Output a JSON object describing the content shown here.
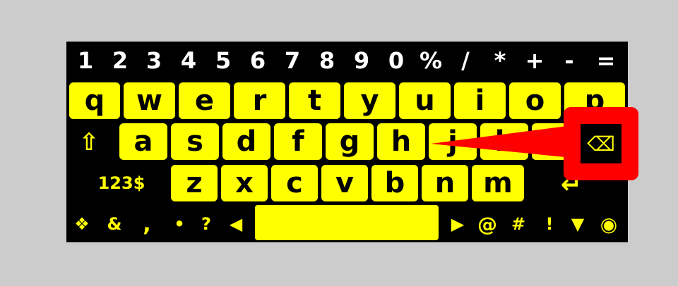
{
  "keyboard": {
    "number_row": [
      "1",
      "2",
      "3",
      "4",
      "5",
      "6",
      "7",
      "8",
      "9",
      "0",
      "%",
      "/",
      "*",
      "+",
      "-",
      "="
    ],
    "row1": [
      "q",
      "w",
      "e",
      "r",
      "t",
      "y",
      "u",
      "i",
      "o",
      "p"
    ],
    "row2": [
      "a",
      "s",
      "d",
      "f",
      "g",
      "h",
      "j",
      "k"
    ],
    "row3": [
      "z",
      "x",
      "c",
      "v",
      "b",
      "n",
      "m"
    ],
    "shift_label": "⇧",
    "mode_label": "123$",
    "enter_label": "↵",
    "space_label": "",
    "bottom_left": [
      "❖",
      "&",
      ",",
      "•",
      "?",
      "◀"
    ],
    "bottom_right": [
      "▶",
      "@",
      "#",
      "!",
      "▼",
      "◉"
    ],
    "backspace_label": "⌫"
  },
  "colors": {
    "key_fill": "#ffff00",
    "keyboard_bg": "#000000",
    "callout": "#ff0000",
    "page_bg": "#cccccc"
  },
  "icons": {
    "shift": "shift-arrow-icon",
    "backspace": "backspace-icon",
    "enter": "enter-arrow-icon",
    "settings": "four-diamond-icon"
  }
}
